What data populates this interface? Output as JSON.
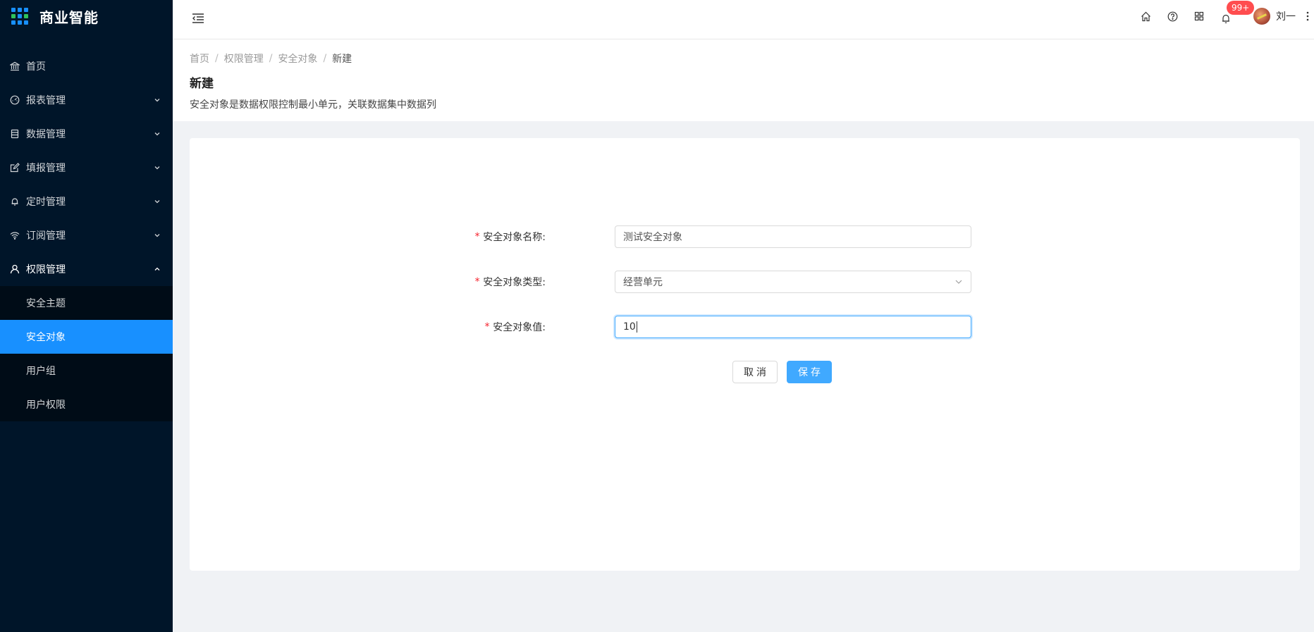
{
  "app": {
    "title": "商业智能"
  },
  "sidebar": {
    "items": [
      {
        "label": "首页",
        "icon": "bank-icon"
      },
      {
        "label": "报表管理",
        "icon": "dashboard-icon"
      },
      {
        "label": "数据管理",
        "icon": "database-icon"
      },
      {
        "label": "填报管理",
        "icon": "edit-icon"
      },
      {
        "label": "定时管理",
        "icon": "bell-icon"
      },
      {
        "label": "订阅管理",
        "icon": "wifi-icon"
      },
      {
        "label": "权限管理",
        "icon": "user-icon",
        "expanded": true
      }
    ],
    "subitems": [
      {
        "label": "安全主题"
      },
      {
        "label": "安全对象",
        "active": true
      },
      {
        "label": "用户组"
      },
      {
        "label": "用户权限"
      }
    ]
  },
  "header": {
    "notification_count": "99+",
    "username": "刘一"
  },
  "breadcrumb": [
    "首页",
    "权限管理",
    "安全对象",
    "新建"
  ],
  "page": {
    "title": "新建",
    "description": "安全对象是数据权限控制最小单元，关联数据集中数据列"
  },
  "form": {
    "name_label": "安全对象名称:",
    "name_value": "测试安全对象",
    "type_label": "安全对象类型:",
    "type_value": "经营单元",
    "value_label": "安全对象值:",
    "value_value": "10",
    "cancel_label": "取消",
    "save_label": "保存"
  },
  "colors": {
    "sidebar_bg": "#001529",
    "submenu_bg": "#000c17",
    "primary": "#1890ff",
    "badge": "#ff4d4f",
    "required": "#f5222d"
  }
}
